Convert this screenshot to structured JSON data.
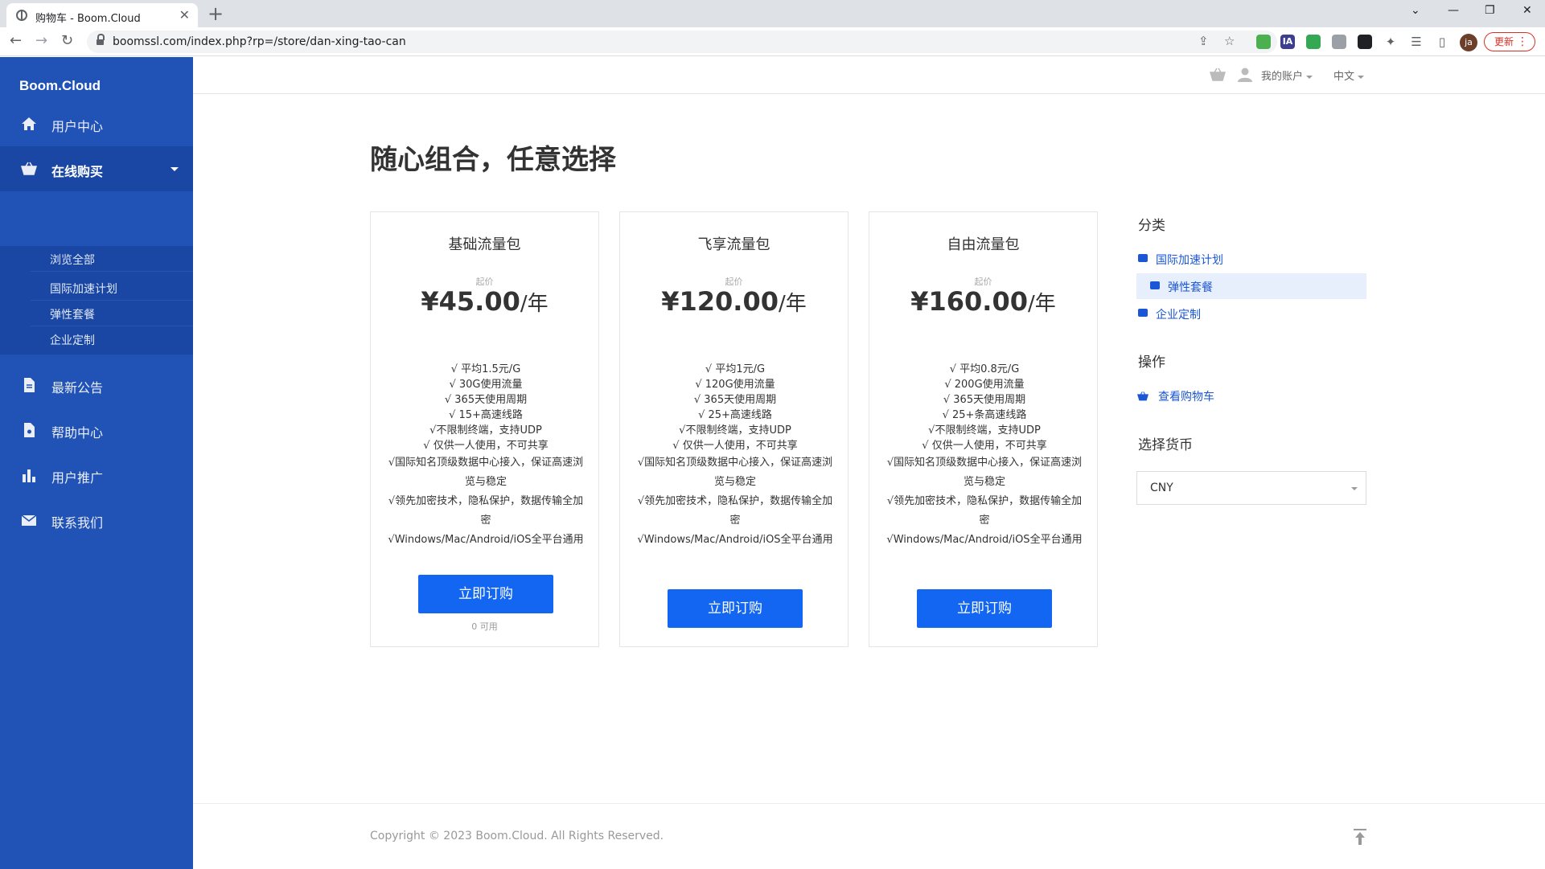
{
  "browser": {
    "tab_title": "购物车 - Boom.Cloud",
    "url": "boomssl.com/index.php?rp=/store/dan-xing-tao-can",
    "profile_initials": "ja",
    "update_label": "更新",
    "extension_labels": [
      "IA"
    ]
  },
  "sidebar": {
    "brand": "Boom.Cloud",
    "items": [
      {
        "label": "用户中心",
        "icon": "home-icon"
      },
      {
        "label": "在线购买",
        "icon": "basket-icon"
      },
      {
        "label": "最新公告",
        "icon": "document-icon"
      },
      {
        "label": "帮助中心",
        "icon": "help-document-icon"
      },
      {
        "label": "用户推广",
        "icon": "bar-chart-icon"
      },
      {
        "label": "联系我们",
        "icon": "envelope-icon"
      }
    ],
    "submenu": [
      "浏览全部",
      "国际加速计划",
      "弹性套餐",
      "企业定制"
    ]
  },
  "topbar": {
    "account_label": "我的账户",
    "language_label": "中文"
  },
  "main": {
    "title": "随心组合，任意选择",
    "products": [
      {
        "name": "基础流量包",
        "from_label": "起价",
        "price": "¥45.00",
        "period": "/年",
        "features": [
          "√ 平均1.5元/G",
          "√ 30G使用流量",
          "√ 365天使用周期",
          "√ 15+高速线路",
          "√不限制终端，支持UDP",
          "√ 仅供一人使用，不可共享",
          "√国际知名顶级数据中心接入，保证高速浏览与稳定",
          "√领先加密技术，隐私保护，数据传输全加密",
          "√Windows/Mac/Android/iOS全平台通用"
        ],
        "buy_label": "立即订购",
        "availability": "0 可用"
      },
      {
        "name": "飞享流量包",
        "from_label": "起价",
        "price": "¥120.00",
        "period": "/年",
        "features": [
          "√ 平均1元/G",
          "√ 120G使用流量",
          "√ 365天使用周期",
          "√ 25+高速线路",
          "√不限制终端，支持UDP",
          "√ 仅供一人使用，不可共享",
          "√国际知名顶级数据中心接入，保证高速浏览与稳定",
          "√领先加密技术，隐私保护，数据传输全加密",
          "√Windows/Mac/Android/iOS全平台通用"
        ],
        "buy_label": "立即订购"
      },
      {
        "name": "自由流量包",
        "from_label": "起价",
        "price": "¥160.00",
        "period": "/年",
        "features": [
          "√ 平均0.8元/G",
          "√ 200G使用流量",
          "√ 365天使用周期",
          "√ 25+条高速线路",
          "√不限制终端，支持UDP",
          "√ 仅供一人使用，不可共享",
          "√国际知名顶级数据中心接入，保证高速浏览与稳定",
          "√领先加密技术，隐私保护，数据传输全加密",
          "√Windows/Mac/Android/iOS全平台通用"
        ],
        "buy_label": "立即订购"
      }
    ]
  },
  "panel": {
    "categories_heading": "分类",
    "categories": [
      "国际加速计划",
      "弹性套餐",
      "企业定制"
    ],
    "actions_heading": "操作",
    "view_cart": "查看购物车",
    "currency_heading": "选择货币",
    "currency_value": "CNY"
  },
  "footer": {
    "copyright": "Copyright © 2023 Boom.Cloud. All Rights Reserved."
  },
  "colors": {
    "sidebar": "#2152b6",
    "primary_button": "#1266f1",
    "link": "#1a56d6"
  }
}
